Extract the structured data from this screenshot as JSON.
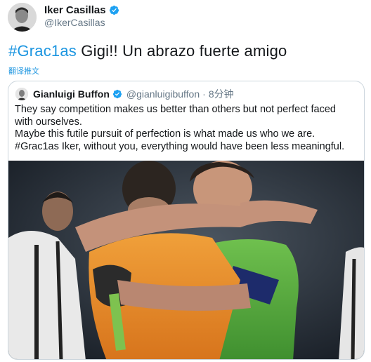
{
  "author": {
    "name": "Iker Casillas",
    "handle": "@IkerCasillas",
    "avatar_icon": "profile-photo-icon",
    "verified_icon": "verified-badge-icon"
  },
  "tweet": {
    "hashtag": "#Grac1as",
    "text": " Gigi!! Un abrazo fuerte amigo",
    "translate_label": "翻译推文"
  },
  "quoted_tweet": {
    "author_name": "Gianluigi Buffon",
    "handle": "@gianluigibuffon",
    "separator": "·",
    "time": "8分钟",
    "lines": [
      "They say competition makes us better than others but not perfect faced",
      "with ourselves.",
      "Maybe this futile pursuit of perfection is what made us who we are.",
      "#Grac1as Iker, without you, everything would have been less meaningful."
    ],
    "photo_icon": "embrace-photo-icon"
  },
  "colors": {
    "link": "#1b95e0",
    "verified": "#1da1f2",
    "border": "#ccd6dd"
  }
}
